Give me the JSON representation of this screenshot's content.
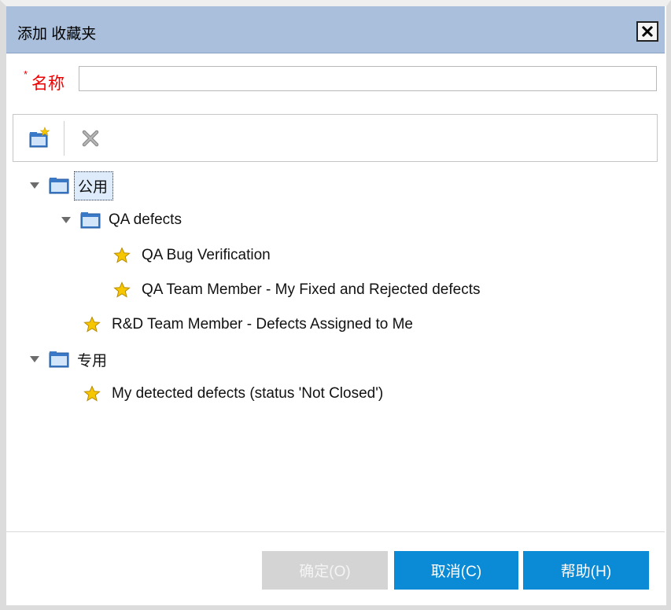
{
  "dialog": {
    "title": "添加 收藏夹",
    "close_label": "✕"
  },
  "name_field": {
    "required_mark": "*",
    "label": "名称",
    "value": "",
    "placeholder": ""
  },
  "toolbar": {
    "new_folder_icon": "new-folder-icon",
    "delete_icon": "delete-icon"
  },
  "tree": {
    "public": {
      "label": "公用",
      "expanded": true,
      "selected": true,
      "qa_defects": {
        "label": "QA defects",
        "expanded": true,
        "items": [
          "QA Bug Verification",
          "QA Team Member - My Fixed and Rejected defects"
        ]
      },
      "items": [
        "R&D Team Member - Defects Assigned to Me"
      ]
    },
    "private": {
      "label": "专用",
      "expanded": true,
      "items": [
        "My detected defects (status 'Not Closed')"
      ]
    }
  },
  "buttons": {
    "ok_label": "确定(O)",
    "ok_enabled": false,
    "cancel_label": "取消(C)",
    "help_label": "帮助(H)"
  },
  "colors": {
    "titlebar": "#a9bfdc",
    "primary_button": "#0b8bd6",
    "disabled_button": "#d4d4d4",
    "required": "#e00000",
    "star": "#f2c200"
  }
}
